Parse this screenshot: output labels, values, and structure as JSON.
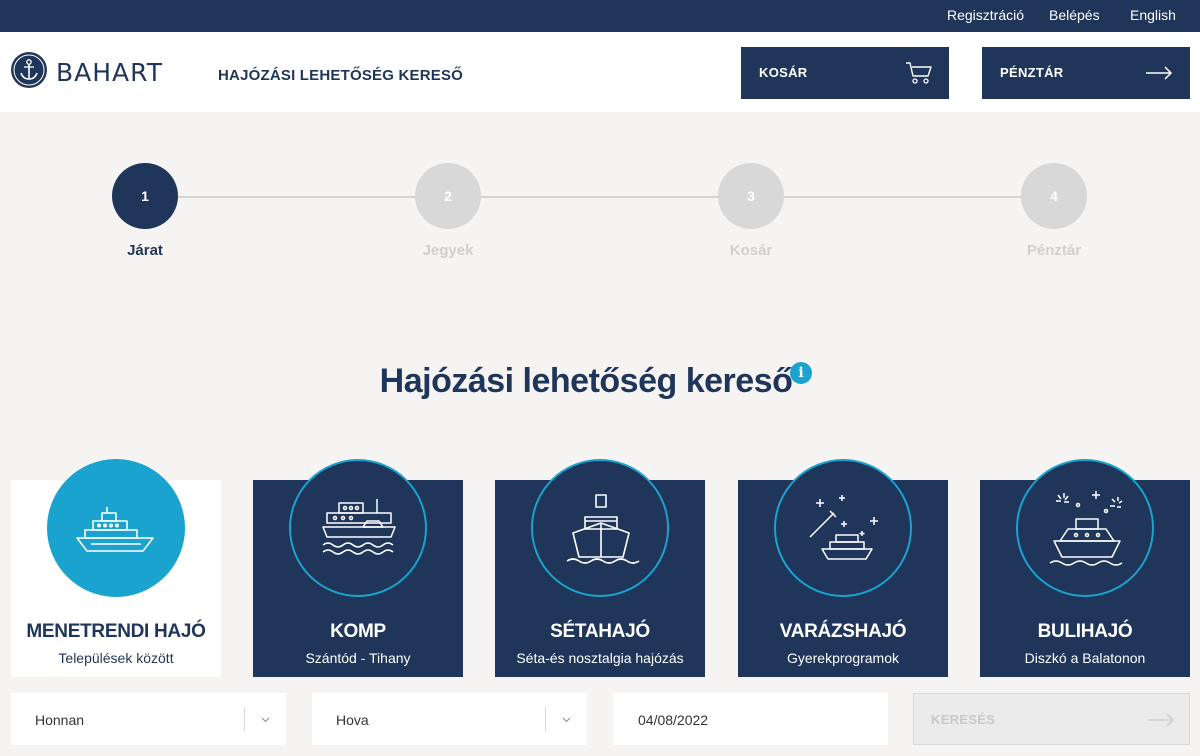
{
  "topnav": {
    "register": "Regisztráció",
    "login": "Belépés",
    "language": "English"
  },
  "header": {
    "brand": "BAHART",
    "title": "HAJÓZÁSI LEHETŐSÉG KERESŐ",
    "cart_button": "KOSÁR",
    "checkout_button": "PÉNZTÁR"
  },
  "stepper": {
    "current": 1,
    "steps": [
      {
        "number": "1",
        "label": "Járat"
      },
      {
        "number": "2",
        "label": "Jegyek"
      },
      {
        "number": "3",
        "label": "Kosár"
      },
      {
        "number": "4",
        "label": "Pénztár"
      }
    ]
  },
  "main": {
    "title": "Hajózási lehetőség kereső",
    "info_icon": "i"
  },
  "categories": [
    {
      "title": "MENETRENDI HAJÓ",
      "subtitle": "Települések között",
      "icon": "ship-icon",
      "selected": true
    },
    {
      "title": "KOMP",
      "subtitle": "Szántód - Tihany",
      "icon": "ferry-icon",
      "selected": false
    },
    {
      "title": "SÉTAHAJÓ",
      "subtitle": "Séta-és nosztalgia hajózás",
      "icon": "boat-icon",
      "selected": false
    },
    {
      "title": "VARÁZSHAJÓ",
      "subtitle": "Gyerekprogramok",
      "icon": "magic-boat-icon",
      "selected": false
    },
    {
      "title": "BULIHAJÓ",
      "subtitle": "Diszkó a Balatonon",
      "icon": "party-boat-icon",
      "selected": false
    }
  ],
  "search": {
    "from": "Honnan",
    "to": "Hova",
    "date": "04/08/2022",
    "button": "KERESÉS"
  },
  "colors": {
    "navy": "#1f3559",
    "accent": "#1aa3cf",
    "background": "#f5f4f2"
  }
}
